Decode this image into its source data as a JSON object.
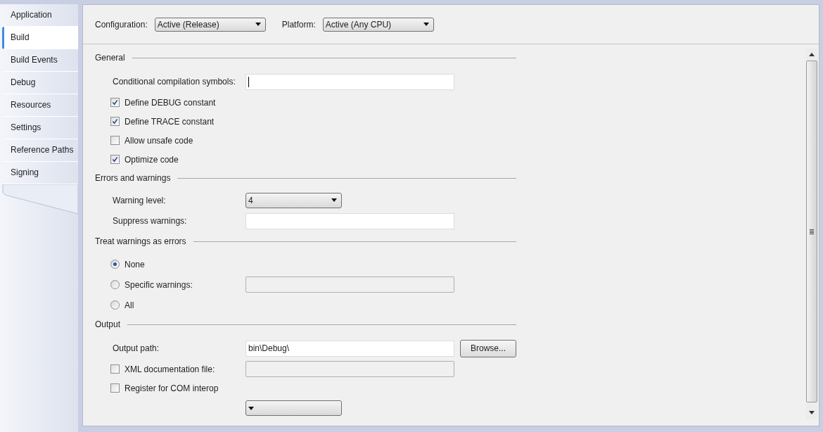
{
  "tabs": [
    {
      "label": "Application",
      "selected": false
    },
    {
      "label": "Build",
      "selected": true
    },
    {
      "label": "Build Events",
      "selected": false
    },
    {
      "label": "Debug",
      "selected": false
    },
    {
      "label": "Resources",
      "selected": false
    },
    {
      "label": "Settings",
      "selected": false
    },
    {
      "label": "Reference Paths",
      "selected": false
    },
    {
      "label": "Signing",
      "selected": false
    }
  ],
  "toolbar": [
    {
      "label": "Configuration:",
      "value": "Active (Release)"
    },
    {
      "label": "Platform:",
      "value": "Active (Any CPU)"
    }
  ],
  "sections": [
    {
      "title": "General",
      "rows": [
        {
          "kind": "text",
          "label": "Conditional compilation symbols:",
          "focused": true,
          "disabled": false
        },
        {
          "kind": "check",
          "label": "Define DEBUG constant",
          "checked": true
        },
        {
          "kind": "check",
          "label": "Define TRACE constant",
          "checked": true
        },
        {
          "kind": "check",
          "label": "Allow unsafe code",
          "checked": false
        },
        {
          "kind": "check",
          "label": "Optimize code",
          "checked": true
        }
      ]
    },
    {
      "title": "Errors and warnings",
      "rows": [
        {
          "kind": "dropdown",
          "label": "Warning level:",
          "value": "4"
        },
        {
          "kind": "text",
          "label": "Suppress warnings:",
          "focused": false,
          "disabled": false
        }
      ]
    },
    {
      "title": "Treat warnings as errors",
      "rows": [
        {
          "kind": "radio",
          "label": "None",
          "selected": true
        },
        {
          "kind": "radio",
          "label": "Specific warnings:",
          "selected": false,
          "field": {
            "disabled": true
          }
        },
        {
          "kind": "radio",
          "label": "All",
          "selected": false
        }
      ]
    },
    {
      "title": "Output",
      "rows": [
        {
          "kind": "text",
          "label": "Output path:",
          "value": "bin\\Debug\\",
          "focused": false,
          "disabled": false,
          "button": "Browse..."
        },
        {
          "kind": "check",
          "label": "XML documentation file:",
          "checked": false,
          "field": {
            "disabled": true
          }
        },
        {
          "kind": "check",
          "label": "Register for COM interop",
          "checked": false
        },
        {
          "kind": "dropdown"
        }
      ]
    }
  ]
}
